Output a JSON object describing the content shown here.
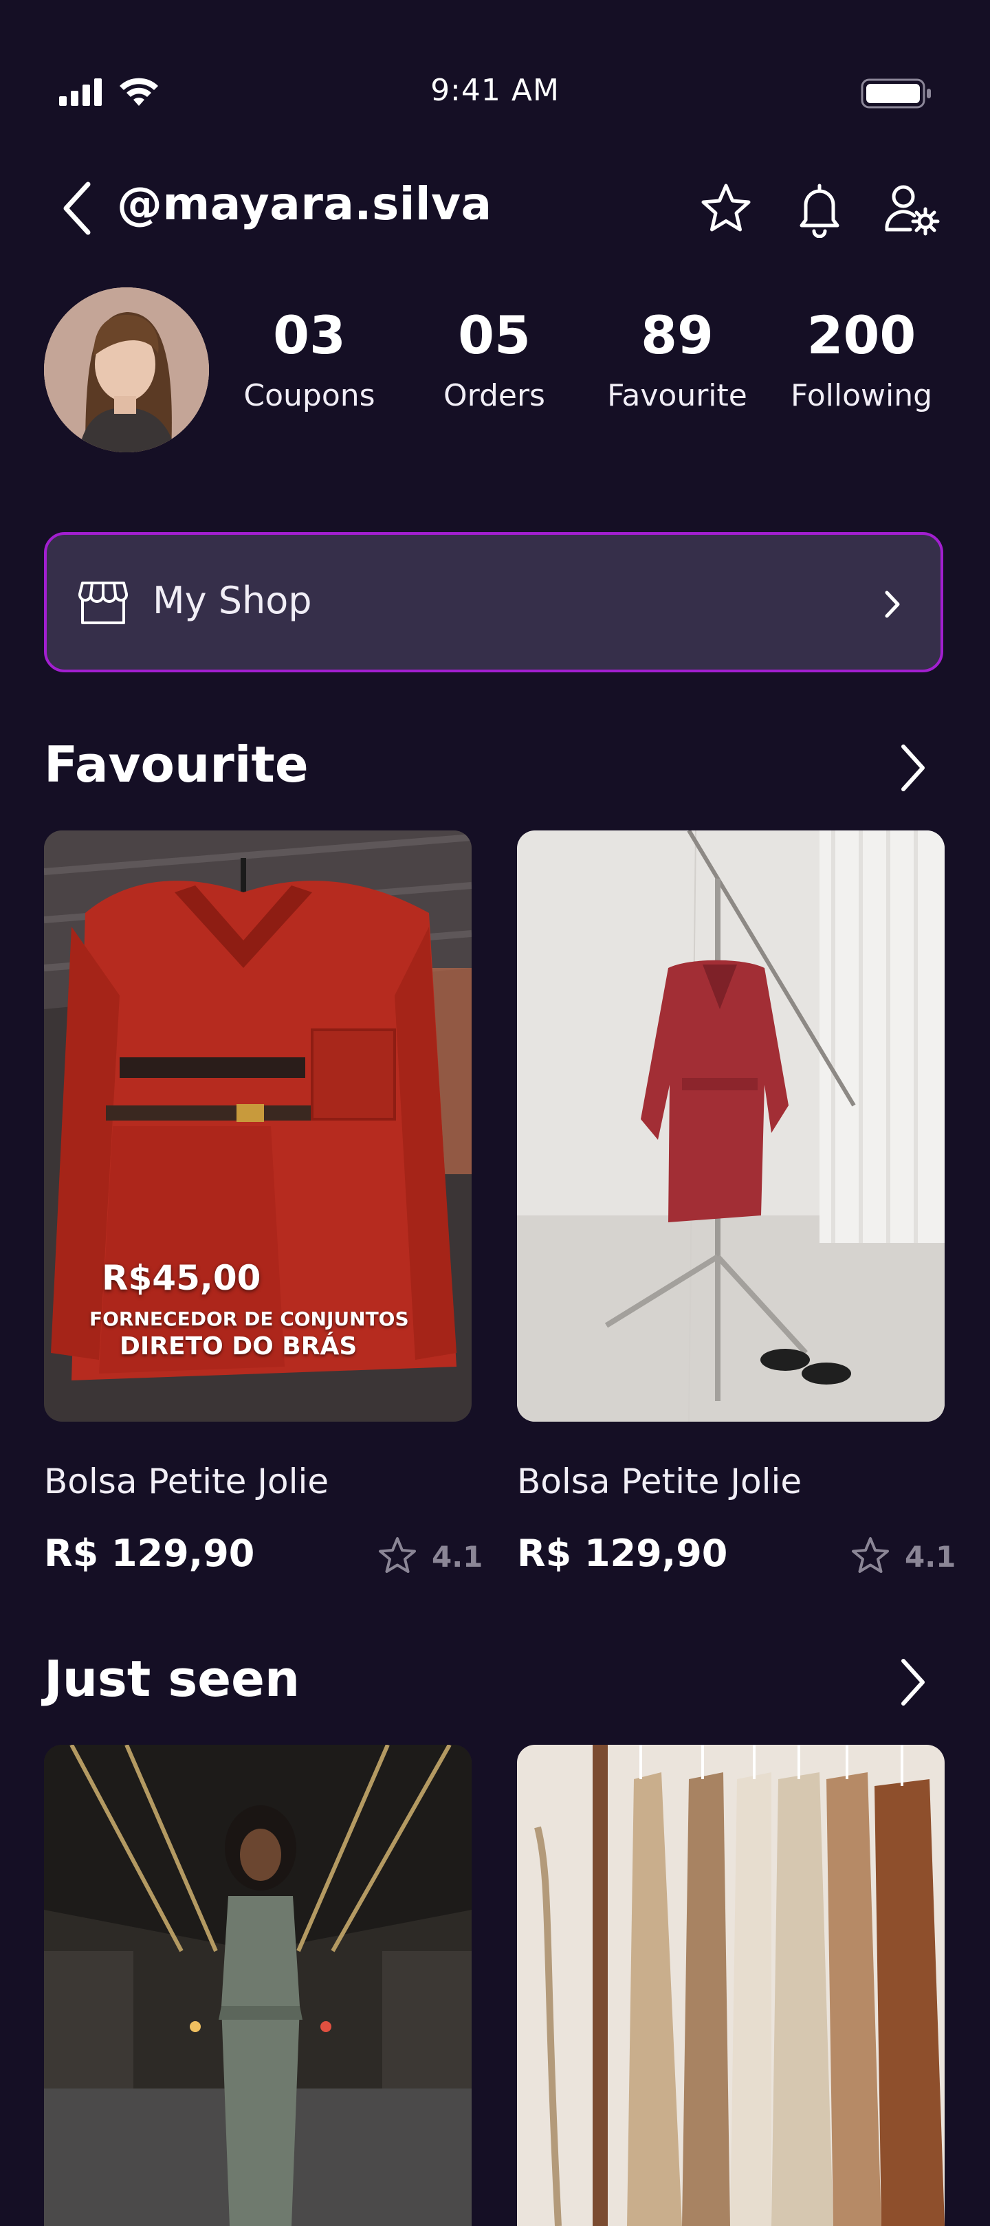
{
  "status_bar": {
    "time": "9:41 AM",
    "signal_icon": "cellular-signal-icon",
    "wifi_icon": "wifi-icon",
    "battery_icon": "battery-icon"
  },
  "header": {
    "back_icon": "chevron-left-icon",
    "username": "@mayara.silva",
    "icons": [
      "star-icon",
      "bell-icon",
      "user-settings-icon"
    ]
  },
  "profile": {
    "stats": [
      {
        "value": "03",
        "label": "Coupons"
      },
      {
        "value": "05",
        "label": "Orders"
      },
      {
        "value": "89",
        "label": "Favourite"
      },
      {
        "value": "200",
        "label": "Following"
      }
    ]
  },
  "my_shop": {
    "label": "My Shop",
    "icon": "storefront-icon"
  },
  "favourite": {
    "title": "Favourite",
    "items": [
      {
        "name": "Bolsa Petite Jolie",
        "price": "R$ 129,90",
        "rating": "4.1",
        "image_overlay": {
          "price": "R$45,00",
          "line1": "FORNECEDOR DE CONJUNTOS",
          "line2": "DIRETO DO BRÁS"
        }
      },
      {
        "name": "Bolsa Petite Jolie",
        "price": "R$ 129,90",
        "rating": "4.1"
      }
    ]
  },
  "just_seen": {
    "title": "Just seen"
  },
  "colors": {
    "background": "#150f25",
    "shop_card": "#362f4a",
    "shop_border": "#a21fd0",
    "muted_text": "#8b8696"
  }
}
